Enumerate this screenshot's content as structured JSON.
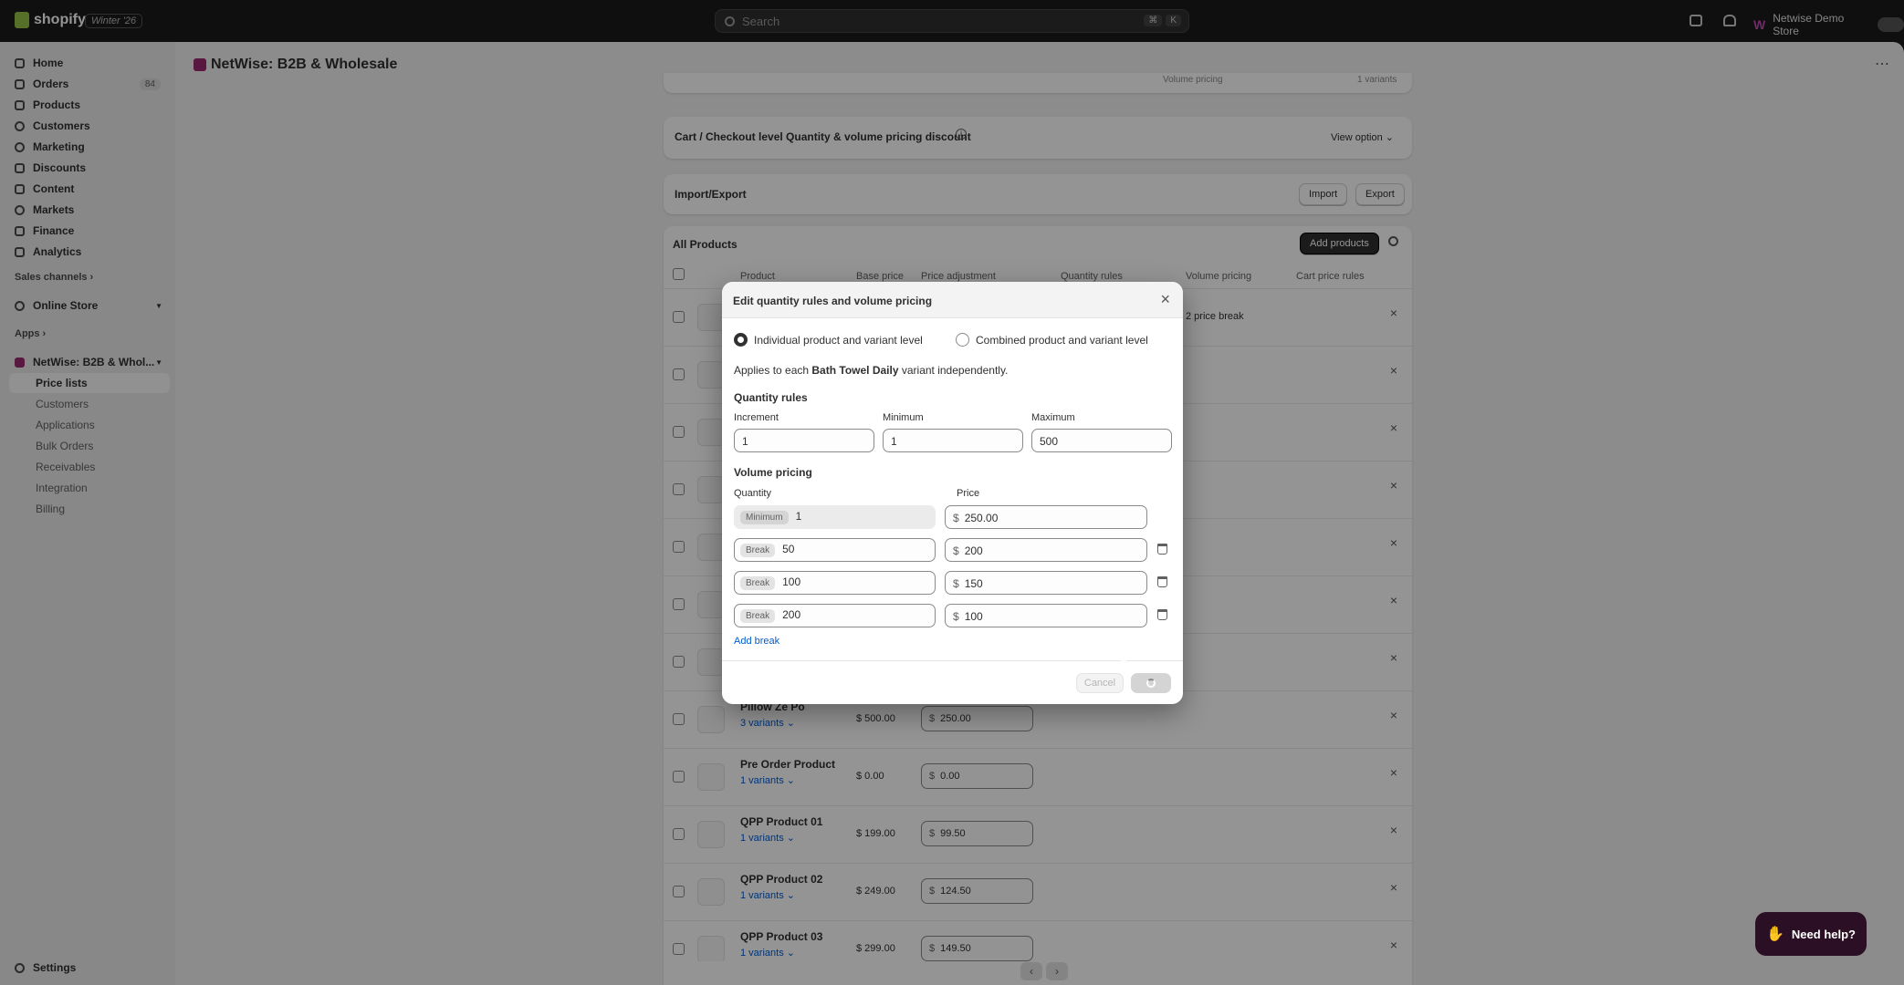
{
  "topbar": {
    "brand": "shopify",
    "edition_badge": "Winter '26",
    "search_placeholder": "Search",
    "shortcut_keys": [
      "⌘",
      "K"
    ],
    "store_name": "Netwise Demo Store"
  },
  "sidebar": {
    "items": [
      {
        "label": "Home",
        "icon": "home-icon"
      },
      {
        "label": "Orders",
        "icon": "orders-icon",
        "count": "84"
      },
      {
        "label": "Products",
        "icon": "tag-icon"
      },
      {
        "label": "Customers",
        "icon": "person-icon"
      },
      {
        "label": "Marketing",
        "icon": "target-icon"
      },
      {
        "label": "Discounts",
        "icon": "discount-icon"
      },
      {
        "label": "Content",
        "icon": "content-icon"
      },
      {
        "label": "Markets",
        "icon": "globe-icon"
      },
      {
        "label": "Finance",
        "icon": "bank-icon"
      },
      {
        "label": "Analytics",
        "icon": "chart-icon"
      }
    ],
    "sales_channels_label": "Sales channels",
    "online_store_label": "Online Store",
    "apps_label": "Apps",
    "app_name": "NetWise: B2B & Whol...",
    "app_subitems": [
      "Price lists",
      "Customers",
      "Applications",
      "Bulk Orders",
      "Receivables",
      "Integration",
      "Billing"
    ],
    "settings_label": "Settings"
  },
  "page": {
    "app_title": "NetWise: B2B & Wholesale",
    "partial_header_left": "Volume pricing",
    "partial_header_right": "1 variants",
    "cart_section_title": "Cart / Checkout level Quantity & volume pricing discount",
    "view_option_label": "View option",
    "import_export_title": "Import/Export",
    "import_label": "Import",
    "export_label": "Export",
    "all_products_title": "All Products",
    "add_products_label": "Add products",
    "columns": [
      "Product",
      "Base price",
      "Price adjustment",
      "Quantity rules",
      "Volume pricing",
      "Cart price rules"
    ],
    "first_row_volume": "2 price break",
    "rows": [
      {
        "name": "Pillow Ze Po",
        "variants": "3 variants",
        "base": "$ 500.00",
        "adj": "250.00"
      },
      {
        "name": "Pre Order Product",
        "variants": "1 variants",
        "base": "$ 0.00",
        "adj": "0.00"
      },
      {
        "name": "QPP Product 01",
        "variants": "1 variants",
        "base": "$ 199.00",
        "adj": "99.50"
      },
      {
        "name": "QPP Product 02",
        "variants": "1 variants",
        "base": "$ 249.00",
        "adj": "124.50"
      },
      {
        "name": "QPP Product 03",
        "variants": "1 variants",
        "base": "$ 299.00",
        "adj": "149.50"
      }
    ],
    "currency": "$"
  },
  "modal": {
    "title": "Edit quantity rules and volume pricing",
    "option_individual": "Individual product and variant level",
    "option_combined": "Combined product and variant level",
    "applies_prefix": "Applies to each ",
    "applies_product": "Bath Towel Daily",
    "applies_suffix": " variant independently.",
    "quantity_rules_heading": "Quantity rules",
    "increment_label": "Increment",
    "increment_value": "1",
    "minimum_label": "Minimum",
    "minimum_value": "1",
    "maximum_label": "Maximum",
    "maximum_value": "500",
    "volume_heading": "Volume pricing",
    "quantity_col": "Quantity",
    "price_col": "Price",
    "tiers": [
      {
        "tag": "Minimum",
        "qty": "1",
        "price": "250.00"
      },
      {
        "tag": "Break",
        "qty": "50",
        "price": "200"
      },
      {
        "tag": "Break",
        "qty": "100",
        "price": "150"
      },
      {
        "tag": "Break",
        "qty": "200",
        "price": "100"
      }
    ],
    "add_break_label": "Add break",
    "cancel_label": "Cancel"
  },
  "help_label": "Need help?"
}
